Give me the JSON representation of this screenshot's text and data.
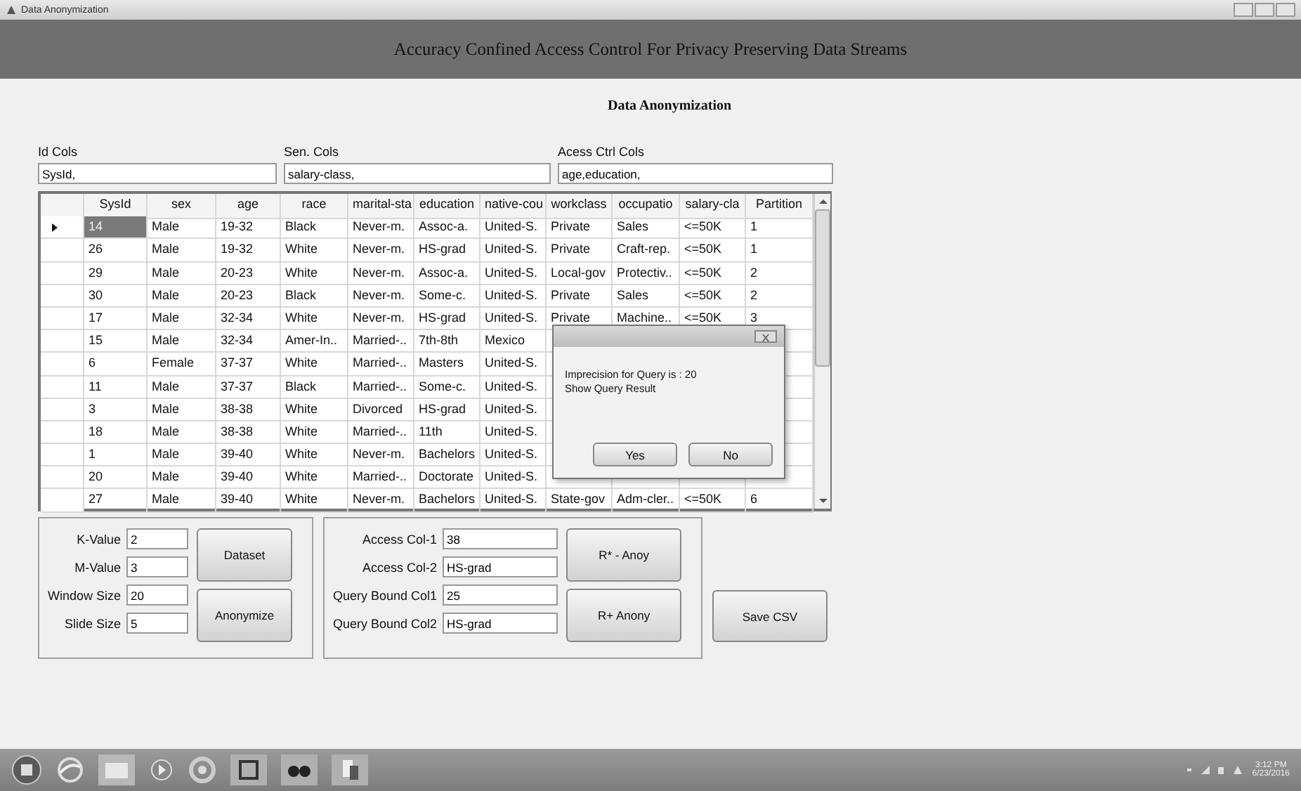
{
  "window": {
    "title": "Data Anonymization"
  },
  "header": {
    "title": "Accuracy Confined Access Control For Privacy Preserving Data Streams"
  },
  "section_title": "Data Anonymization",
  "column_fields": [
    {
      "label": "Id Cols",
      "value": "SysId,"
    },
    {
      "label": "Sen. Cols",
      "value": "salary-class,"
    },
    {
      "label": "Acess Ctrl Cols",
      "value": "age,education,"
    }
  ],
  "table": {
    "columns": [
      "SysId",
      "sex",
      "age",
      "race",
      "marital-sta",
      "education",
      "native-cou",
      "workclass",
      "occupatio",
      "salary-cla",
      "Partition"
    ],
    "rows": [
      {
        "selected": true,
        "cells": [
          "14",
          "Male",
          "19-32",
          "Black",
          "Never-m.",
          "Assoc-a.",
          "United-S.",
          "Private",
          "Sales",
          "<=50K",
          "1"
        ]
      },
      {
        "selected": false,
        "cells": [
          "26",
          "Male",
          "19-32",
          "White",
          "Never-m.",
          "HS-grad",
          "United-S.",
          "Private",
          "Craft-rep.",
          "<=50K",
          "1"
        ]
      },
      {
        "selected": false,
        "cells": [
          "29",
          "Male",
          "20-23",
          "White",
          "Never-m.",
          "Assoc-a.",
          "United-S.",
          "Local-gov",
          "Protectiv..",
          "<=50K",
          "2"
        ]
      },
      {
        "selected": false,
        "cells": [
          "30",
          "Male",
          "20-23",
          "Black",
          "Never-m.",
          "Some-c.",
          "United-S.",
          "Private",
          "Sales",
          "<=50K",
          "2"
        ]
      },
      {
        "selected": false,
        "cells": [
          "17",
          "Male",
          "32-34",
          "White",
          "Never-m.",
          "HS-grad",
          "United-S.",
          "Private",
          "Machine..",
          "<=50K",
          "3"
        ]
      },
      {
        "selected": false,
        "cells": [
          "15",
          "Male",
          "32-34",
          "Amer-In..",
          "Married-..",
          "7th-8th",
          "Mexico"
        ]
      },
      {
        "selected": false,
        "cells": [
          "6",
          "Female",
          "37-37",
          "White",
          "Married-..",
          "Masters",
          "United-S."
        ]
      },
      {
        "selected": false,
        "cells": [
          "11",
          "Male",
          "37-37",
          "Black",
          "Married-..",
          "Some-c.",
          "United-S."
        ]
      },
      {
        "selected": false,
        "cells": [
          "3",
          "Male",
          "38-38",
          "White",
          "Divorced",
          "HS-grad",
          "United-S."
        ]
      },
      {
        "selected": false,
        "cells": [
          "18",
          "Male",
          "38-38",
          "White",
          "Married-..",
          "11th",
          "United-S."
        ]
      },
      {
        "selected": false,
        "cells": [
          "1",
          "Male",
          "39-40",
          "White",
          "Never-m.",
          "Bachelors",
          "United-S."
        ]
      },
      {
        "selected": false,
        "cells": [
          "20",
          "Male",
          "39-40",
          "White",
          "Married-..",
          "Doctorate",
          "United-S."
        ]
      },
      {
        "selected": false,
        "cells": [
          "27",
          "Male",
          "39-40",
          "White",
          "Never-m.",
          "Bachelors",
          "United-S.",
          "State-gov",
          "Adm-cler..",
          "<=50K",
          "6"
        ]
      }
    ]
  },
  "dialog": {
    "message_lines": [
      "Imprecision for Query is : 20",
      "Show Query Result"
    ],
    "buttons": [
      "Yes",
      "No"
    ]
  },
  "parameters": [
    {
      "label": "K-Value",
      "value": "2"
    },
    {
      "label": "M-Value",
      "value": "3"
    },
    {
      "label": "Window Size",
      "value": "20"
    },
    {
      "label": "Slide Size",
      "value": "5"
    }
  ],
  "parameter_buttons": [
    "Dataset",
    "Anonymize"
  ],
  "query_fields": [
    {
      "label": "Access Col-1",
      "value": "38"
    },
    {
      "label": "Access Col-2",
      "value": "HS-grad"
    },
    {
      "label": "Query Bound Col1",
      "value": "25"
    },
    {
      "label": "Query Bound Col2",
      "value": "HS-grad"
    }
  ],
  "query_buttons": [
    "R* - Anoy",
    "R+ Anony"
  ],
  "save_button": "Save CSV",
  "taskbar": {
    "time": "3:12 PM",
    "date": "6/23/2016"
  }
}
